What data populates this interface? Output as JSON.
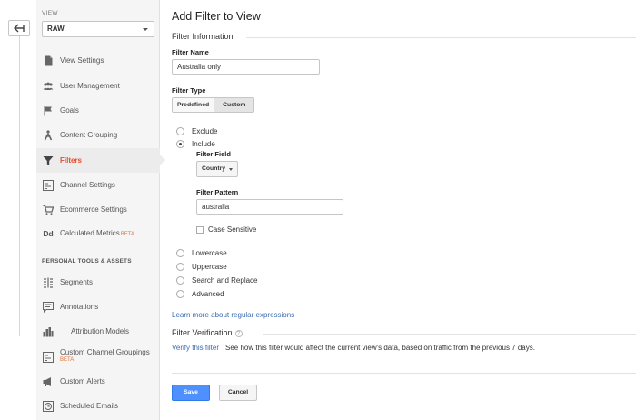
{
  "sidebar": {
    "view_label": "VIEW",
    "view_selected": "RAW",
    "items": [
      {
        "label": "View Settings",
        "icon": "document-icon"
      },
      {
        "label": "User Management",
        "icon": "users-icon"
      },
      {
        "label": "Goals",
        "icon": "flag-icon"
      },
      {
        "label": "Content Grouping",
        "icon": "person-walk-icon"
      },
      {
        "label": "Filters",
        "icon": "funnel-icon",
        "active": true
      },
      {
        "label": "Channel Settings",
        "icon": "channel-settings-icon"
      },
      {
        "label": "Ecommerce Settings",
        "icon": "cart-icon"
      },
      {
        "label": "Calculated Metrics",
        "icon": "dd-icon",
        "icon_text": "Dd",
        "badge": "BETA"
      }
    ],
    "section_label": "PERSONAL TOOLS & ASSETS",
    "tools": [
      {
        "label": "Segments",
        "icon": "segments-icon"
      },
      {
        "label": "Annotations",
        "icon": "annotation-icon"
      },
      {
        "label": "Attribution Models",
        "icon": "bar-chart-icon"
      },
      {
        "label": "Custom Channel Groupings",
        "icon": "channel-grouping-icon",
        "badge": "BETA"
      },
      {
        "label": "Custom Alerts",
        "icon": "megaphone-icon"
      },
      {
        "label": "Scheduled Emails",
        "icon": "clock-icon"
      }
    ]
  },
  "main": {
    "title": "Add Filter to View",
    "filter_information": "Filter Information",
    "filter_name_label": "Filter Name",
    "filter_name_value": "Australia only",
    "filter_type_label": "Filter Type",
    "type_tabs": [
      "Predefined",
      "Custom"
    ],
    "type_selected": "Custom",
    "options": {
      "exclude": "Exclude",
      "include": "Include",
      "lowercase": "Lowercase",
      "uppercase": "Uppercase",
      "search_replace": "Search and Replace",
      "advanced": "Advanced"
    },
    "selected_option": "Include",
    "filter_field_label": "Filter Field",
    "filter_field_value": "Country",
    "filter_pattern_label": "Filter Pattern",
    "filter_pattern_value": "australia",
    "case_sensitive_label": "Case Sensitive",
    "learn_more": "Learn more about regular expressions",
    "filter_verification": "Filter Verification",
    "help_glyph": "?",
    "verify_link": "Verify this filter",
    "verify_text": "See how this filter would affect the current view's data, based on traffic from the previous 7 days.",
    "save_label": "Save",
    "cancel_label": "Cancel"
  },
  "colors": {
    "accent_blue": "#4d90fe",
    "active_nav": "#e34e30",
    "link": "#3b6bb0",
    "beta": "#e36f30"
  }
}
